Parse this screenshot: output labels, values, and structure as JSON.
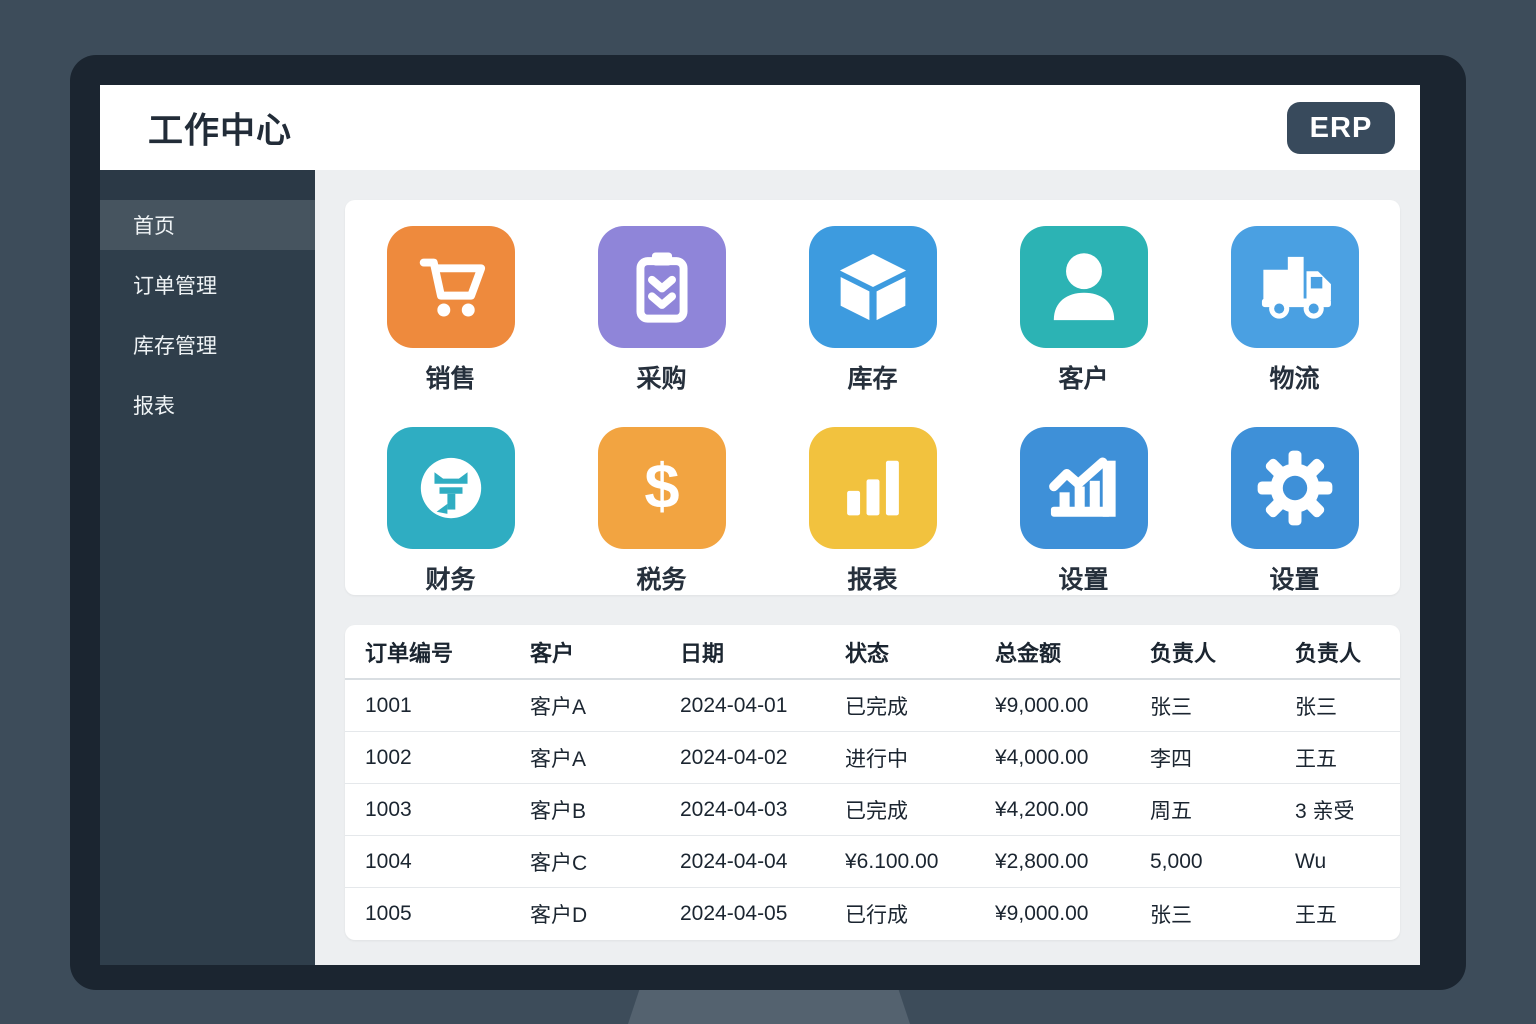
{
  "header": {
    "title": "工作中心",
    "badge": "ERP"
  },
  "sidebar": {
    "items": [
      {
        "label": "首页",
        "active": true
      },
      {
        "label": "订单管理",
        "active": false
      },
      {
        "label": "库存管理",
        "active": false
      },
      {
        "label": "报表",
        "active": false
      }
    ]
  },
  "apps": [
    {
      "label": "销售",
      "icon": "cart-icon",
      "color": "#EE8A3D"
    },
    {
      "label": "采购",
      "icon": "clipboard-icon",
      "color": "#8F85D9"
    },
    {
      "label": "库存",
      "icon": "cube-icon",
      "color": "#3D9BDF"
    },
    {
      "label": "客户",
      "icon": "person-icon",
      "color": "#2CB3B4"
    },
    {
      "label": "物流",
      "icon": "truck-icon",
      "color": "#4AA0E2"
    },
    {
      "label": "财务",
      "icon": "coin-icon",
      "color": "#2FADC2"
    },
    {
      "label": "税务",
      "icon": "dollar-icon",
      "color": "#F2A441"
    },
    {
      "label": "报表",
      "icon": "bar-chart-icon",
      "color": "#F2C23E"
    },
    {
      "label": "设置",
      "icon": "chart-line-icon",
      "color": "#3E90D8"
    },
    {
      "label": "设置",
      "icon": "gear-icon",
      "color": "#3E90D8"
    }
  ],
  "orders_table": {
    "columns": [
      "订单编号",
      "客户",
      "日期",
      "状态",
      "总金额",
      "负责人",
      "负责人"
    ],
    "rows": [
      [
        "1001",
        "客户A",
        "2024-04-01",
        "已完成",
        "¥9,000.00",
        "张三",
        "张三"
      ],
      [
        "1002",
        "客户A",
        "2024-04-02",
        "进行中",
        "¥4,000.00",
        "李四",
        "王五"
      ],
      [
        "1003",
        "客户B",
        "2024-04-03",
        "已完成",
        "¥4,200.00",
        "周五",
        "3 亲受"
      ],
      [
        "1004",
        "客户C",
        "2024-04-04",
        "¥6.100.00",
        "¥2,800.00",
        "5,000",
        "Wu"
      ],
      [
        "1005",
        "客户D",
        "2024-04-05",
        "已行成",
        "¥9,000.00",
        "张三",
        "王五"
      ]
    ]
  },
  "colors": {
    "desk_background": "#3D4C5A",
    "monitor_bezel": "#1B2530",
    "sidebar": "#2F3E4B",
    "sidebar_active": "#46545F",
    "content_background": "#EDEFF1",
    "erp_badge": "#384A5C"
  }
}
